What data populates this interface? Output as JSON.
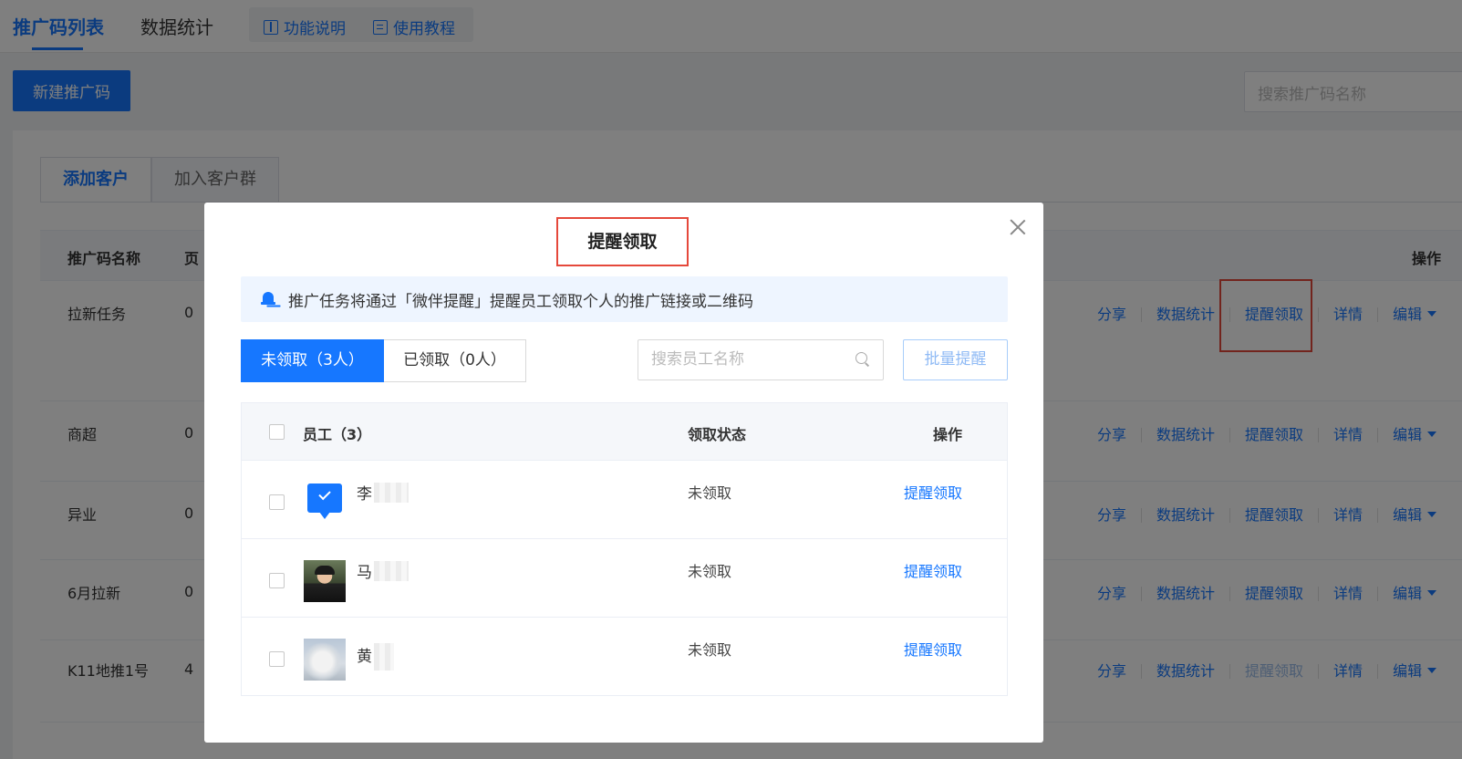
{
  "topnav": {
    "tabs": [
      "推广码列表",
      "数据统计"
    ],
    "help": [
      "功能说明",
      "使用教程"
    ]
  },
  "toolbar": {
    "new_button": "新建推广码",
    "search_placeholder": "搜索推广码名称"
  },
  "subtabs": [
    "添加客户",
    "加入客户群"
  ],
  "table": {
    "headers": {
      "name": "推广码名称",
      "col2": "页",
      "col3": "",
      "ops": "操作"
    },
    "rows": [
      {
        "name": "拉新任务",
        "num": "0"
      },
      {
        "name": "商超",
        "num": "0"
      },
      {
        "name": "异业",
        "num": "0"
      },
      {
        "name": "6月拉新",
        "num": "0"
      },
      {
        "name": "K11地推1号",
        "num": "4"
      }
    ],
    "ops": [
      "分享",
      "数据统计",
      "提醒领取",
      "详情",
      "编辑"
    ]
  },
  "modal": {
    "title": "提醒领取",
    "notice": "推广任务将通过「微伴提醒」提醒员工领取个人的推广链接或二维码",
    "seg": {
      "unclaimed": "未领取（3人）",
      "claimed": "已领取（0人）"
    },
    "search_placeholder": "搜索员工名称",
    "batch_button": "批量提醒",
    "headers": {
      "employee": "员工（3）",
      "status": "领取状态",
      "ops": "操作"
    },
    "rows": [
      {
        "name": "李",
        "status": "未领取",
        "op": "提醒领取"
      },
      {
        "name": "马",
        "status": "未领取",
        "op": "提醒领取"
      },
      {
        "name": "黄",
        "status": "未领取",
        "op": "提醒领取"
      }
    ]
  },
  "colors": {
    "accent": "#1677ff",
    "highlight": "#e5483b"
  }
}
